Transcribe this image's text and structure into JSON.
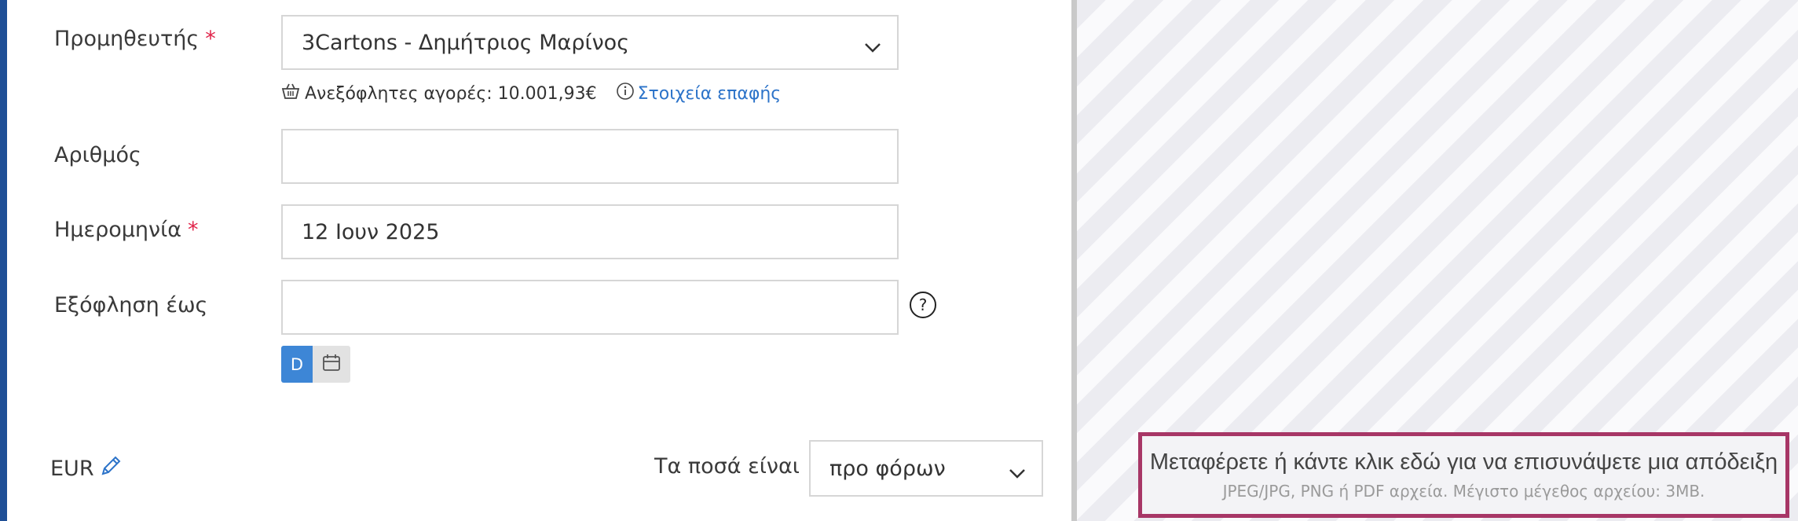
{
  "form": {
    "supplier": {
      "label": "Προμηθευτής",
      "required_mark": "*",
      "value": "3Cartons - Δημήτριος Μαρίνος"
    },
    "supplier_meta": {
      "unpaid_purchases": "Ανεξόφλητες αγορές: 10.001,93€",
      "contact_link": "Στοιχεία επαφής"
    },
    "number": {
      "label": "Αριθμός",
      "value": ""
    },
    "date": {
      "label": "Ημερομηνία",
      "required_mark": "*",
      "value": "12 Ιουν 2025"
    },
    "due_date": {
      "label": "Εξόφληση έως",
      "value": ""
    },
    "date_mode": {
      "d_label": "D"
    },
    "currency": {
      "label": "EUR"
    },
    "amounts": {
      "label": "Τα ποσά είναι",
      "value": "προ φόρων"
    }
  },
  "dropzone": {
    "title": "Μεταφέρετε ή κάντε κλικ εδώ για να επισυνάψετε μια απόδειξη",
    "subtitle": "JPEG/JPG, PNG ή PDF αρχεία. Μέγιστο μέγεθος αρχείου: 3MB."
  },
  "icons": [
    "basket-icon",
    "info-icon",
    "chevron-down-icon",
    "help-icon",
    "calendar-icon",
    "pencil-icon"
  ],
  "colors": {
    "accent": "#1f4f96",
    "required": "#e0244a",
    "link": "#2c73c9",
    "button": "#3d86d6",
    "dropzone_border": "#a73666"
  }
}
